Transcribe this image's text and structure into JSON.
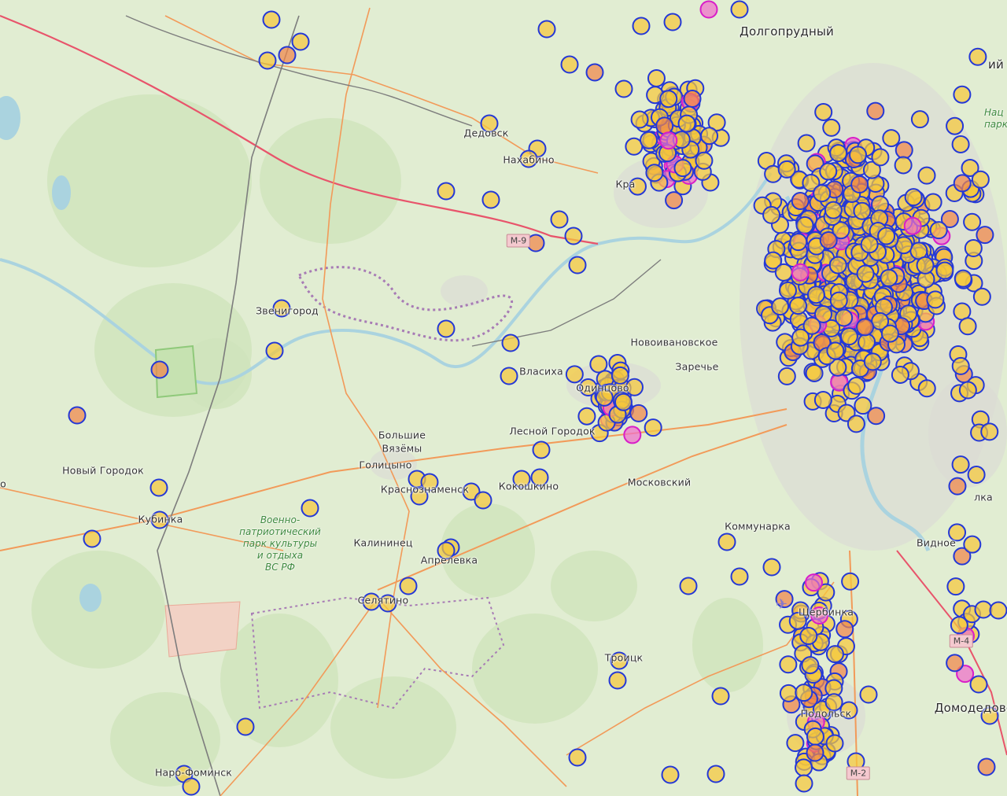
{
  "places": [
    {
      "id": "dolgoprudny",
      "text": "Долгопрудный",
      "big": true
    },
    {
      "id": "dedovsk",
      "text": "Дедовск"
    },
    {
      "id": "nakhabino",
      "text": "Нахабино"
    },
    {
      "id": "krasnogorsk",
      "text": "Кра"
    },
    {
      "id": "zvenigorod",
      "text": "Звенигород"
    },
    {
      "id": "novoivankovskoe",
      "text": "Новоивановское"
    },
    {
      "id": "zarechye",
      "text": "Заречье"
    },
    {
      "id": "vlasikha",
      "text": "Власиха"
    },
    {
      "id": "odintsovo",
      "text": "Одинцово"
    },
    {
      "id": "bolshie-vyazemy-1",
      "text": "Большие"
    },
    {
      "id": "bolshie-vyazemy-2",
      "text": "Вязёмы"
    },
    {
      "id": "lesnoy-gorodok",
      "text": "Лесной Городок"
    },
    {
      "id": "novy-gorodok",
      "text": "Новый Городок"
    },
    {
      "id": "golitsyno",
      "text": "Голицыно"
    },
    {
      "id": "krasnoznamensk",
      "text": "Краснознаменск"
    },
    {
      "id": "kokoshkino",
      "text": "Кокошкино"
    },
    {
      "id": "moskovsky",
      "text": "Московский"
    },
    {
      "id": "kubinka",
      "text": "Кубинка"
    },
    {
      "id": "kommunarka",
      "text": "Коммунарка"
    },
    {
      "id": "kalininets",
      "text": "Калининец"
    },
    {
      "id": "aprelevka",
      "text": "Апрелевка"
    },
    {
      "id": "vidnoe",
      "text": "Видное"
    },
    {
      "id": "selyatino",
      "text": "Селятино"
    },
    {
      "id": "shcherbinka",
      "text": "Щербинка"
    },
    {
      "id": "troitsk",
      "text": "Троицк"
    },
    {
      "id": "podolsk",
      "text": "Подольск"
    },
    {
      "id": "domodedovo",
      "text": "Домодедово",
      "big": true
    },
    {
      "id": "naro-fominsk",
      "text": "Наро-Фоминск"
    },
    {
      "id": "ilka",
      "text": "лка"
    },
    {
      "id": "edge-o",
      "text": "о"
    },
    {
      "id": "edge-ii",
      "text": "ий"
    }
  ],
  "park_label": [
    "Военно-",
    "патриотический",
    "парк культуры",
    "и отдыха",
    "ВС РФ"
  ],
  "park_label_2": [
    "Нац",
    "парк"
  ],
  "road_shields": [
    {
      "id": "m9",
      "text": "М-9"
    },
    {
      "id": "m4",
      "text": "М-4"
    },
    {
      "id": "m2",
      "text": "М-2"
    }
  ],
  "marker_colors": {
    "yellow": "#f5c83c",
    "orange": "#f0874a",
    "pink": "#ee6fc9",
    "ring_blue": "#2438d6",
    "ring_magenta": "#d81ec8"
  },
  "icons": {
    "airport": "airplane-icon"
  }
}
